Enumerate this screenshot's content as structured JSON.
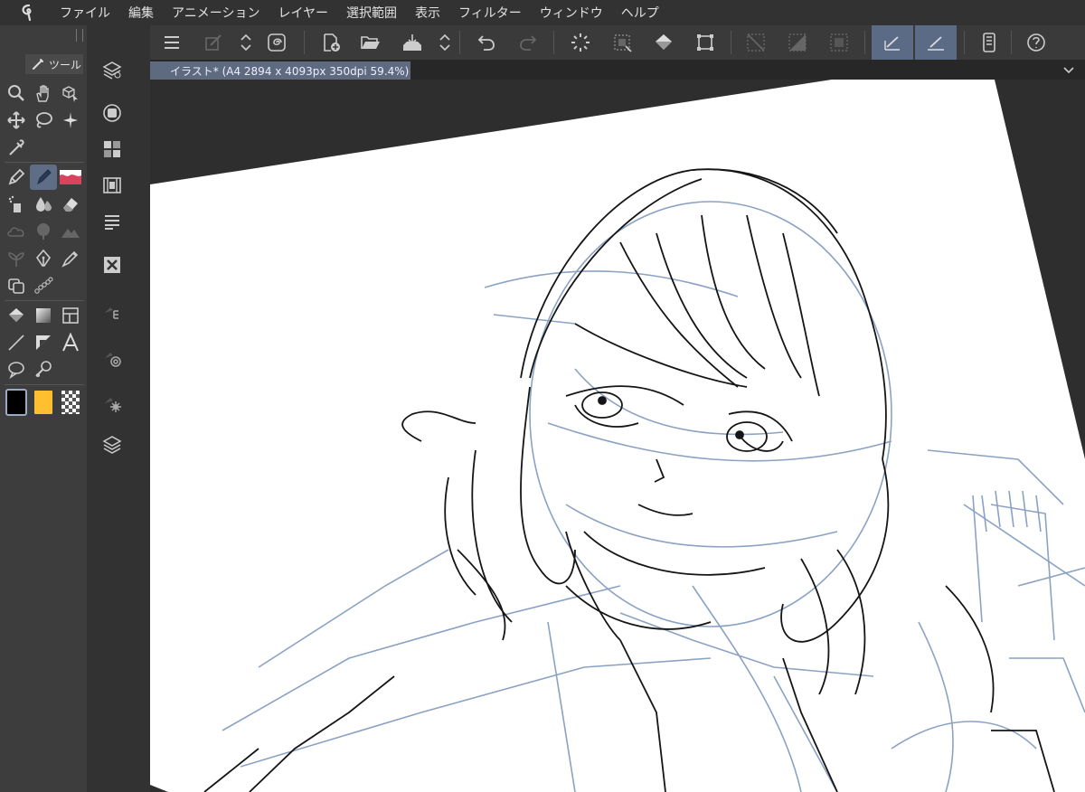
{
  "menu": [
    "ファイル",
    "編集",
    "アニメーション",
    "レイヤー",
    "選択範囲",
    "表示",
    "フィルター",
    "ウィンドウ",
    "ヘルプ"
  ],
  "tool_panel": {
    "tab_label": "ツール"
  },
  "colors": {
    "main": "#000000",
    "sub": "#ffbf2e",
    "transparent": "checker",
    "accent": "#5e6a80"
  },
  "document": {
    "tab_title": "イラスト* (A4 2894 x 4093px 350dpi 59.4%)"
  },
  "tools": [
    [
      "zoom-icon",
      "hand-icon",
      "object-icon"
    ],
    [
      "move-icon",
      "lasso-select-icon",
      "magic-wand-icon"
    ],
    [
      "eyedropper-icon"
    ],
    [
      "pen-icon",
      "pencil-icon",
      "brush-icon"
    ],
    [
      "airbrush-icon",
      "blend-icon",
      "eraser-icon"
    ],
    [
      "cloud-icon",
      "tree-icon",
      "mountain-icon"
    ],
    [
      "plant-icon",
      "fountain-pen-icon",
      "marker-icon"
    ],
    [
      "copy-stamp-icon",
      "beads-icon"
    ],
    [
      "fill-icon",
      "gradient-icon",
      "frame-icon"
    ],
    [
      "line-icon",
      "ruler-icon",
      "text-icon"
    ],
    [
      "balloon-icon",
      "correction-icon"
    ]
  ],
  "commands_left": [
    "layer-props-icon",
    "navigator-icon",
    "material-icon",
    "timeline-icon",
    "layer-list-icon",
    "delete-icon",
    "vector-icon",
    "auto-action-icon",
    "settings-icon",
    "layers-icon"
  ],
  "commands_bar": [
    "menu-icon",
    "new-icon",
    "arrows-icon",
    "swirl-icon",
    "new-file-icon",
    "open-icon",
    "save-icon",
    "arrows-icon",
    "undo-icon",
    "redo-icon",
    "spinner-icon",
    "transform-icon",
    "fill-bucket-icon",
    "crop-icon",
    "deselect-icon",
    "invert-icon",
    "selection-frame-icon",
    "ruler-snap-icon",
    "ruler-edit-icon",
    "device-icon",
    "help-icon"
  ]
}
